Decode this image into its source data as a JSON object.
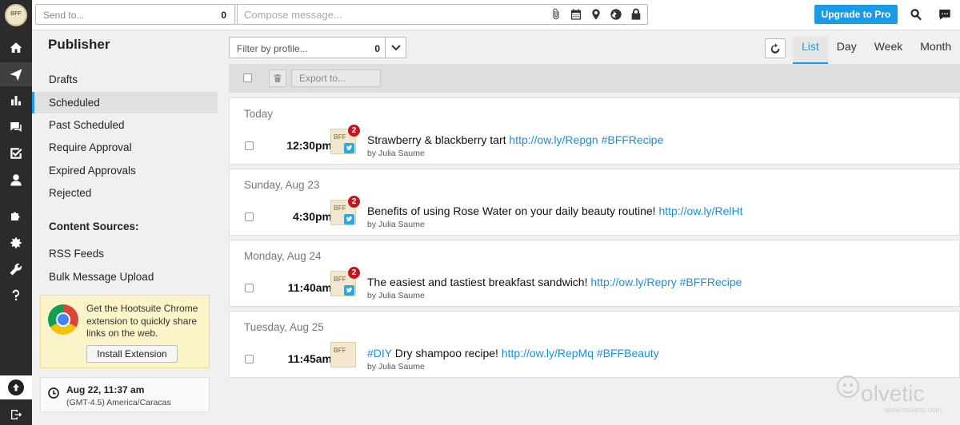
{
  "rail": {
    "logo_text": "BFF",
    "icons": [
      "home-icon",
      "send-icon",
      "analytics-icon",
      "assignments-icon",
      "tasks-icon",
      "contacts-icon",
      "apps-icon",
      "settings-icon",
      "tools-icon",
      "help-icon"
    ]
  },
  "topbar": {
    "send_to_placeholder": "Send to...",
    "send_to_count": "0",
    "compose_placeholder": "Compose message...",
    "upgrade_label": "Upgrade to Pro"
  },
  "sidebar": {
    "title": "Publisher",
    "items": [
      {
        "label": "Drafts"
      },
      {
        "label": "Scheduled"
      },
      {
        "label": "Past Scheduled"
      },
      {
        "label": "Require Approval"
      },
      {
        "label": "Expired Approvals"
      },
      {
        "label": "Rejected"
      }
    ],
    "content_sources_heading": "Content Sources:",
    "sources": [
      {
        "label": "RSS Feeds"
      },
      {
        "label": "Bulk Message Upload"
      }
    ],
    "promo": {
      "text": "Get the Hootsuite Chrome extension to quickly share links on the web.",
      "button_label": "Install Extension"
    },
    "clock": {
      "datetime": "Aug 22, 11:37 am",
      "timezone": "(GMT-4.5) America/Caracas"
    }
  },
  "main": {
    "filter_placeholder": "Filter by profile...",
    "filter_count": "0",
    "views": [
      {
        "label": "List",
        "active": true
      },
      {
        "label": "Day",
        "active": false
      },
      {
        "label": "Week",
        "active": false
      },
      {
        "label": "Month",
        "active": false
      }
    ],
    "export_label": "Export to...",
    "groups": [
      {
        "date": "Today",
        "time": "12:30pm",
        "badge": "2",
        "text": "Strawberry & blackberry tart ",
        "link": "http://ow.ly/Repgn #BFFRecipe",
        "author": "by Julia Saume",
        "network": "twitter"
      },
      {
        "date": "Sunday, Aug 23",
        "time": "4:30pm",
        "badge": "2",
        "text": "Benefits of using Rose Water on your daily beauty routine! ",
        "link": "http://ow.ly/RelHt",
        "author": "by Julia Saume",
        "network": "twitter"
      },
      {
        "date": "Monday, Aug 24",
        "time": "11:40am",
        "badge": "2",
        "text": "The easiest and tastiest breakfast sandwich! ",
        "link": "http://ow.ly/Repry #BFFRecipe",
        "author": "by Julia Saume",
        "network": "twitter"
      },
      {
        "date": "Tuesday, Aug 25",
        "time": "11:45am",
        "badge": "",
        "link_prefix": "#DIY",
        "text": " Dry shampoo recipe! ",
        "link": "http://ow.ly/RepMq #BFFBeauty",
        "author": "by Julia Saume",
        "network": "other"
      }
    ]
  },
  "watermark": {
    "text": "olvetic",
    "url": "www.solvetic.com"
  },
  "colors": {
    "accent": "#1a9be6",
    "rail": "#2b2b2b",
    "badge": "#c8141e",
    "link": "#1a8fd6"
  }
}
